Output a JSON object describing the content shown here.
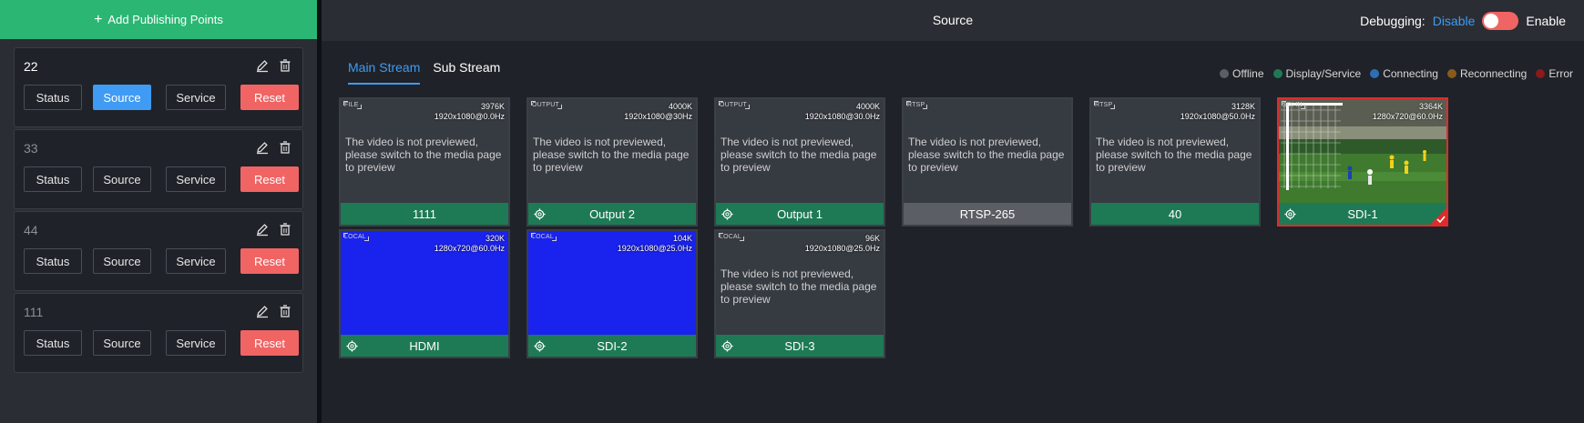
{
  "sidebar": {
    "add_label": "Add Publishing Points",
    "button_labels": {
      "status": "Status",
      "source": "Source",
      "service": "Service",
      "reset": "Reset"
    },
    "points": [
      {
        "name": "22"
      },
      {
        "name": "33"
      },
      {
        "name": "44"
      },
      {
        "name": "111"
      }
    ]
  },
  "header": {
    "title": "Source",
    "debugging_label": "Debugging:",
    "disable_label": "Disable",
    "enable_label": "Enable"
  },
  "tabs": [
    {
      "label": "Main Stream",
      "active": true
    },
    {
      "label": "Sub Stream",
      "active": false
    }
  ],
  "legend": [
    {
      "label": "Offline",
      "color": "#5b5e64"
    },
    {
      "label": "Display/Service",
      "color": "#1e7a55"
    },
    {
      "label": "Connecting",
      "color": "#2f6eb5"
    },
    {
      "label": "Reconnecting",
      "color": "#8a5a1a"
    },
    {
      "label": "Error",
      "color": "#8b1a1a"
    }
  ],
  "preview_message": "The video is not previewed, please switch to the media page to preview",
  "sources": [
    {
      "tag": "FILE",
      "bitrate": "3976K",
      "resolution": "1920x1080@0.0Hz",
      "name": "1111",
      "status": "display",
      "gear": false
    },
    {
      "tag": "OUTPUT",
      "bitrate": "4000K",
      "resolution": "1920x1080@30Hz",
      "name": "Output 2",
      "status": "display",
      "gear": true
    },
    {
      "tag": "OUTPUT",
      "bitrate": "4000K",
      "resolution": "1920x1080@30.0Hz",
      "name": "Output 1",
      "status": "display",
      "gear": true
    },
    {
      "tag": "RTSP",
      "bitrate": "",
      "resolution": "",
      "name": "RTSP-265",
      "status": "offline",
      "gear": false
    },
    {
      "tag": "RTSP",
      "bitrate": "3128K",
      "resolution": "1920x1080@50.0Hz",
      "name": "40",
      "status": "display",
      "gear": false
    },
    {
      "tag": "SDI IN",
      "bitrate": "3364K",
      "resolution": "1280x720@60.0Hz",
      "name": "SDI-1",
      "status": "display",
      "gear": true,
      "selected": true
    },
    {
      "tag": "LOCAL",
      "bitrate": "320K",
      "resolution": "1280x720@60.0Hz",
      "name": "HDMI",
      "status": "display",
      "gear": true
    },
    {
      "tag": "LOCAL",
      "bitrate": "104K",
      "resolution": "1920x1080@25.0Hz",
      "name": "SDI-2",
      "status": "display",
      "gear": true
    },
    {
      "tag": "LOCAL",
      "bitrate": "96K",
      "resolution": "1920x1080@25.0Hz",
      "name": "SDI-3",
      "status": "display",
      "gear": true
    }
  ]
}
